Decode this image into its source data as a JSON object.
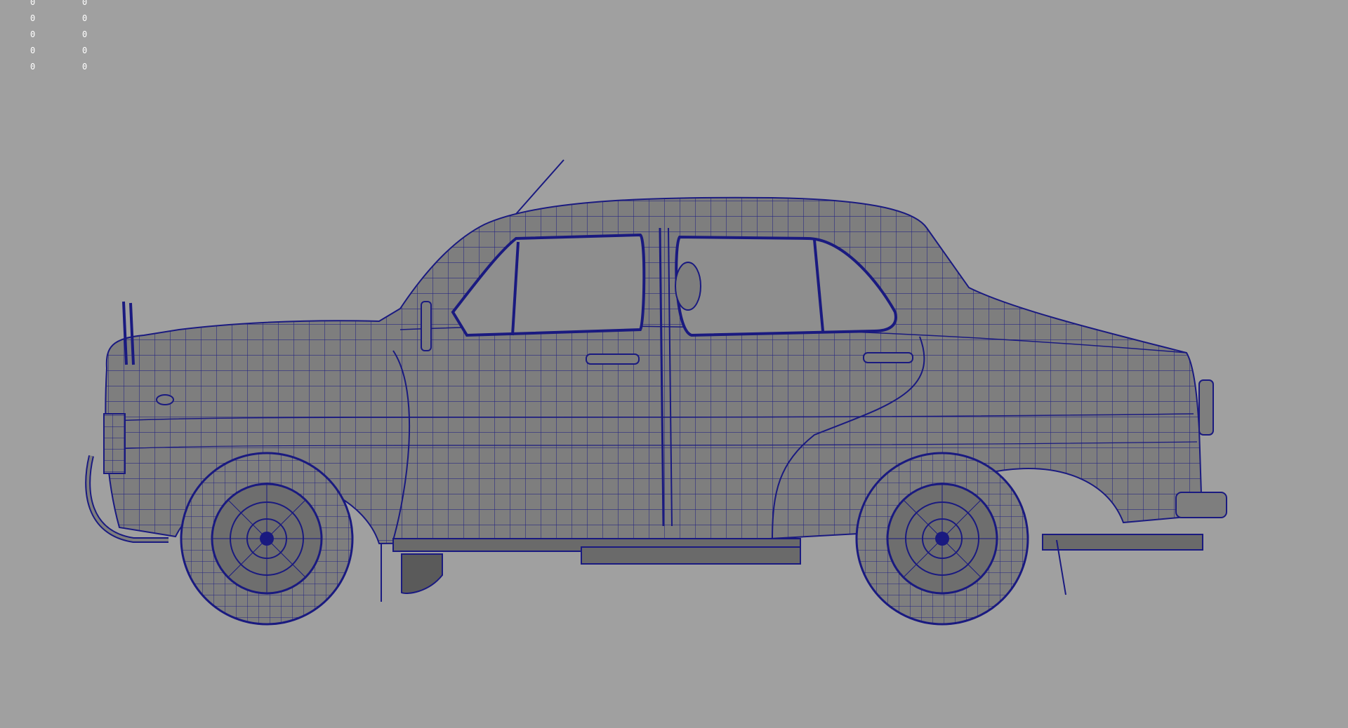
{
  "viewport": {
    "background": "#a0a0a0",
    "wire_color": "#1a1a80",
    "shaded_color": "#7e7e7e",
    "glass_color": "#8e8e8e",
    "shadow_color": "#5a5a5a"
  },
  "hud": {
    "column_1": [
      "0",
      "0",
      "0",
      "0",
      "0"
    ],
    "column_2": [
      "0",
      "0",
      "0",
      "0",
      "0"
    ]
  }
}
